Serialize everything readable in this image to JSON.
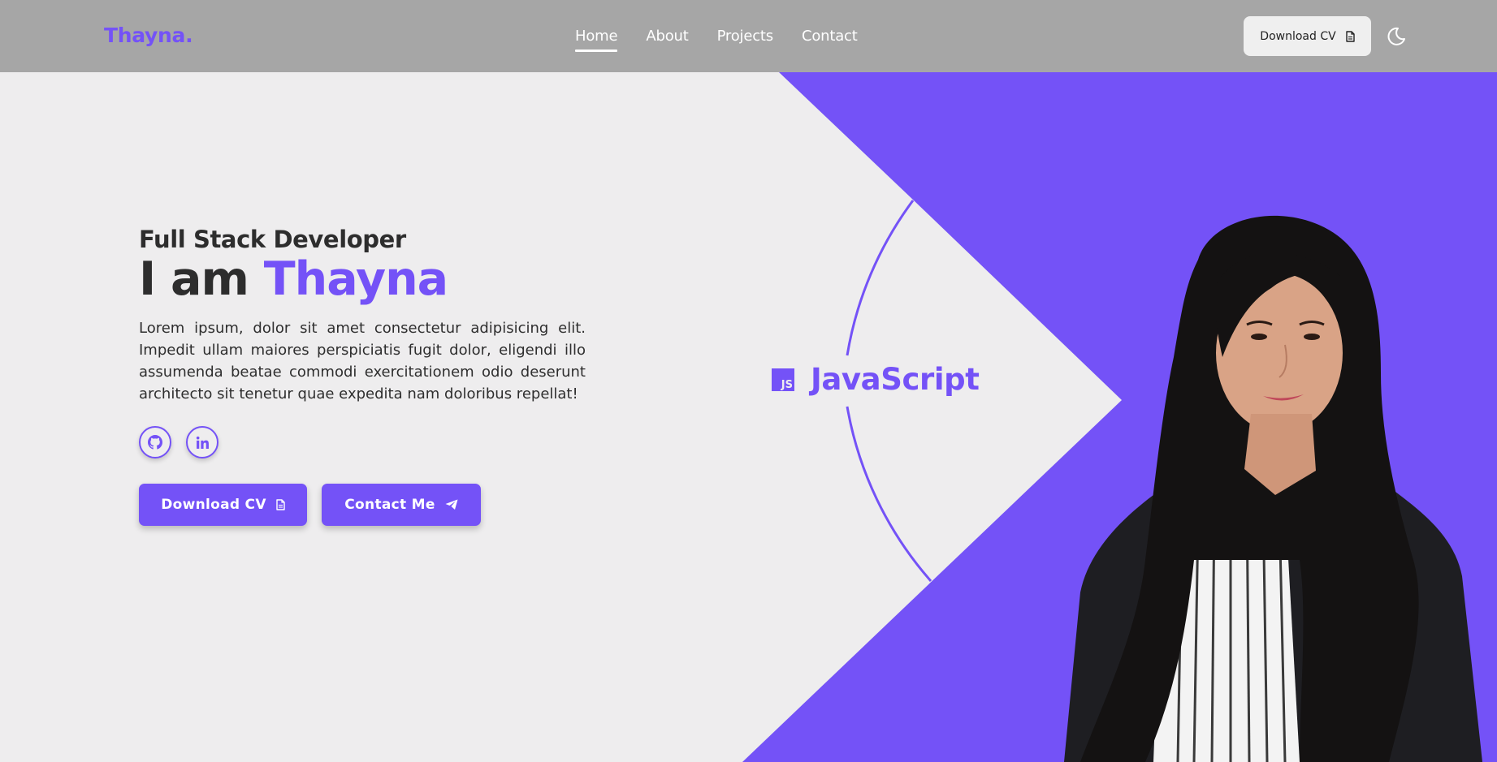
{
  "header": {
    "logo": "Thayna.",
    "nav": [
      "Home",
      "About",
      "Projects",
      "Contact"
    ],
    "active_nav": "Home",
    "download_cv_label": "Download CV",
    "theme_toggle_icon": "moon-icon"
  },
  "hero": {
    "role": "Full Stack Developer",
    "greeting": "I am",
    "name": "Thayna",
    "bio": "Lorem ipsum, dolor sit amet consectetur adipisicing elit. Impedit ullam maiores perspiciatis fugit dolor, eligendi illo assumenda beatae commodi exercitationem odio deserunt architecto sit tenetur quae expedita nam doloribus repellat!",
    "socials": [
      {
        "name": "github",
        "icon": "github-icon"
      },
      {
        "name": "linkedin",
        "icon": "linkedin-icon"
      }
    ],
    "buttons": {
      "download_cv": "Download CV",
      "contact_me": "Contact Me"
    }
  },
  "skill": {
    "badge": "JS",
    "label": "JavaScript"
  },
  "colors": {
    "accent": "#7452f7",
    "header_bg": "#a6a6a6",
    "page_bg": "#eeedee",
    "text_dark": "#2d2d2d"
  }
}
